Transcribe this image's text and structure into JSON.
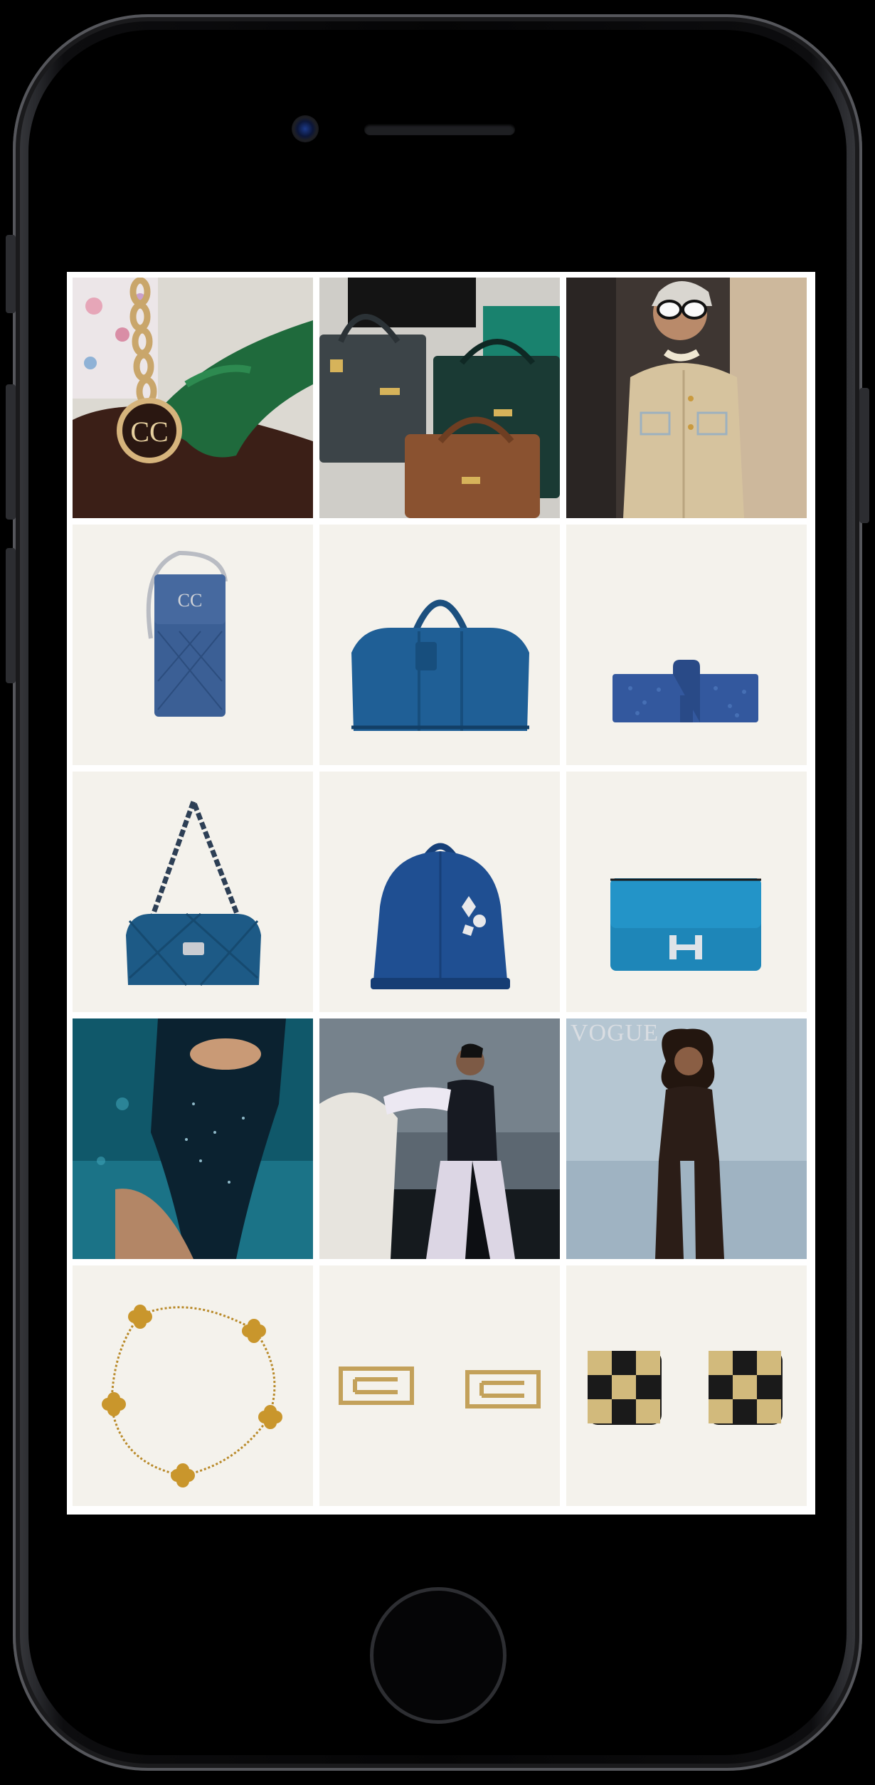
{
  "device": "iphone",
  "grid": {
    "columns": 3,
    "rows": 5,
    "tiles": [
      {
        "id": "chanel-glove",
        "kind": "photo"
      },
      {
        "id": "hermes-kelly-bags",
        "kind": "photo"
      },
      {
        "id": "model-tweed-jacket",
        "kind": "photo"
      },
      {
        "id": "denim-phone-bag",
        "kind": "product"
      },
      {
        "id": "blue-keepall",
        "kind": "product"
      },
      {
        "id": "blue-jige-clutch",
        "kind": "product"
      },
      {
        "id": "blue-quilted-shoulder-bag",
        "kind": "product"
      },
      {
        "id": "blue-alma-bag",
        "kind": "product"
      },
      {
        "id": "blue-constance-bag",
        "kind": "product"
      },
      {
        "id": "underwater-dress",
        "kind": "photo"
      },
      {
        "id": "model-with-horse",
        "kind": "photo"
      },
      {
        "id": "vogue-cover",
        "kind": "photo",
        "masthead": "VOGUE"
      },
      {
        "id": "clover-bracelet",
        "kind": "product"
      },
      {
        "id": "gold-earrings",
        "kind": "product"
      },
      {
        "id": "checker-earrings",
        "kind": "product"
      }
    ]
  },
  "colors": {
    "tile_background": "#f4f2ec",
    "screen_background": "#ffffff",
    "accent_blue": "#1f5f96"
  }
}
